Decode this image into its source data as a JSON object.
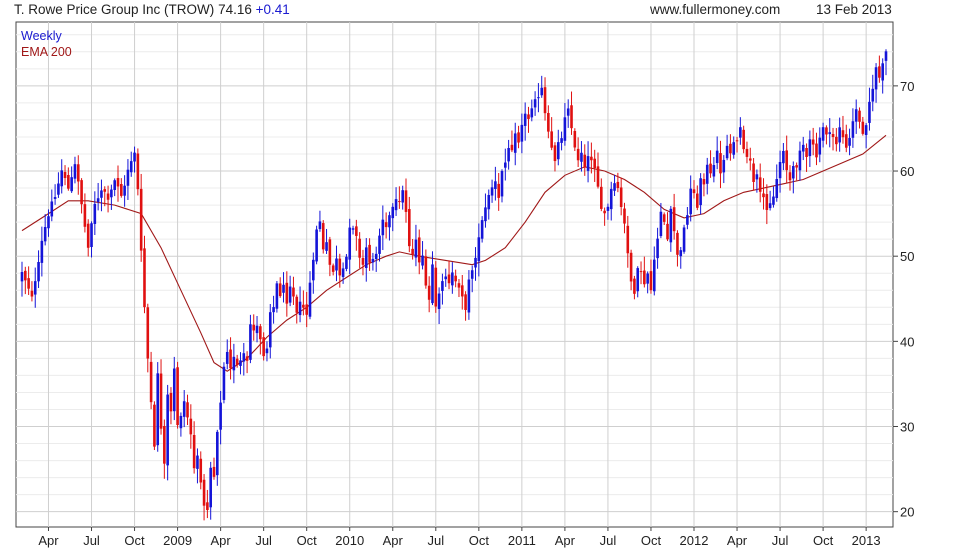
{
  "header": {
    "security_name": "T. Rowe Price Group Inc (TROW)",
    "last_price": "74.16",
    "change": "+0.41",
    "website": "www.fullermoney.com",
    "date": "13 Feb 2013"
  },
  "colors": {
    "up_candle": "#1414d8",
    "down_candle": "#e01010",
    "ema_line": "#a01818",
    "grid": "#cfcfcf",
    "frame": "#444444"
  },
  "chart_data": {
    "type": "candlestick",
    "period": "Weekly",
    "indicator": "EMA 200",
    "y_ticks": [
      20,
      30,
      40,
      50,
      60,
      70
    ],
    "ylim": [
      18.2,
      77.5
    ],
    "x_tick_labels": [
      "Apr",
      "Jul",
      "Oct",
      "2009",
      "Apr",
      "Jul",
      "Oct",
      "2010",
      "Apr",
      "Jul",
      "Oct",
      "2011",
      "Apr",
      "Jul",
      "Oct",
      "2012",
      "Apr",
      "Jul",
      "Oct",
      "2013"
    ],
    "x_tick_weeks": [
      8,
      21,
      34,
      47,
      60,
      73,
      86,
      99,
      112,
      125,
      138,
      151,
      164,
      177,
      190,
      203,
      216,
      229,
      242,
      255
    ],
    "weeks_total": 262,
    "close_path": [
      [
        0,
        48
      ],
      [
        3,
        45
      ],
      [
        6,
        52
      ],
      [
        8,
        55
      ],
      [
        10,
        57
      ],
      [
        12,
        60
      ],
      [
        14,
        58
      ],
      [
        16,
        61
      ],
      [
        18,
        56
      ],
      [
        20,
        51
      ],
      [
        22,
        56
      ],
      [
        24,
        58
      ],
      [
        26,
        57
      ],
      [
        28,
        59
      ],
      [
        30,
        57
      ],
      [
        32,
        60
      ],
      [
        34,
        62
      ],
      [
        35,
        58
      ],
      [
        36,
        51
      ],
      [
        37,
        44
      ],
      [
        38,
        38
      ],
      [
        39,
        33
      ],
      [
        40,
        28
      ],
      [
        41,
        36
      ],
      [
        42,
        30
      ],
      [
        43,
        26
      ],
      [
        44,
        34
      ],
      [
        45,
        32
      ],
      [
        46,
        37
      ],
      [
        47,
        30
      ],
      [
        48,
        31
      ],
      [
        49,
        33
      ],
      [
        50,
        31
      ],
      [
        51,
        29
      ],
      [
        52,
        25
      ],
      [
        53,
        27
      ],
      [
        54,
        23
      ],
      [
        55,
        21
      ],
      [
        56,
        20
      ],
      [
        57,
        25
      ],
      [
        58,
        24
      ],
      [
        59,
        29
      ],
      [
        60,
        33
      ],
      [
        61,
        37
      ],
      [
        62,
        39
      ],
      [
        63,
        37
      ],
      [
        64,
        38
      ],
      [
        65,
        37
      ],
      [
        66,
        38
      ],
      [
        67,
        39
      ],
      [
        68,
        38
      ],
      [
        69,
        42
      ],
      [
        70,
        41
      ],
      [
        71,
        42
      ],
      [
        72,
        40
      ],
      [
        73,
        38
      ],
      [
        74,
        39
      ],
      [
        75,
        43
      ],
      [
        76,
        44
      ],
      [
        77,
        47
      ],
      [
        78,
        45
      ],
      [
        79,
        47
      ],
      [
        80,
        44
      ],
      [
        81,
        46
      ],
      [
        82,
        45
      ],
      [
        83,
        43
      ],
      [
        84,
        45
      ],
      [
        85,
        44
      ],
      [
        86,
        43
      ],
      [
        87,
        47
      ],
      [
        88,
        50
      ],
      [
        89,
        53
      ],
      [
        90,
        54
      ],
      [
        91,
        51
      ],
      [
        92,
        52
      ],
      [
        93,
        49
      ],
      [
        94,
        48
      ],
      [
        95,
        50
      ],
      [
        96,
        48
      ],
      [
        97,
        49
      ],
      [
        98,
        50
      ],
      [
        99,
        53
      ],
      [
        100,
        53
      ],
      [
        101,
        52
      ],
      [
        102,
        50
      ],
      [
        103,
        49
      ],
      [
        104,
        51
      ],
      [
        105,
        49
      ],
      [
        106,
        50
      ],
      [
        107,
        50
      ],
      [
        108,
        52
      ],
      [
        109,
        54
      ],
      [
        110,
        53
      ],
      [
        111,
        55
      ],
      [
        112,
        56
      ],
      [
        113,
        57
      ],
      [
        114,
        56
      ],
      [
        115,
        58
      ],
      [
        116,
        55
      ],
      [
        117,
        51
      ],
      [
        118,
        50
      ],
      [
        119,
        52
      ],
      [
        120,
        49
      ],
      [
        121,
        50
      ],
      [
        122,
        47
      ],
      [
        123,
        45
      ],
      [
        124,
        49
      ],
      [
        125,
        44
      ],
      [
        126,
        46
      ],
      [
        127,
        47
      ],
      [
        128,
        48
      ],
      [
        129,
        47
      ],
      [
        130,
        48
      ],
      [
        131,
        47
      ],
      [
        132,
        46
      ],
      [
        133,
        45
      ],
      [
        134,
        44
      ],
      [
        135,
        47
      ],
      [
        136,
        48
      ],
      [
        137,
        50
      ],
      [
        138,
        52
      ],
      [
        139,
        54
      ],
      [
        140,
        56
      ],
      [
        141,
        57
      ],
      [
        142,
        58
      ],
      [
        143,
        59
      ],
      [
        144,
        57
      ],
      [
        145,
        60
      ],
      [
        146,
        61
      ],
      [
        147,
        63
      ],
      [
        148,
        62
      ],
      [
        149,
        64
      ],
      [
        150,
        63
      ],
      [
        151,
        65
      ],
      [
        152,
        67
      ],
      [
        153,
        66
      ],
      [
        154,
        67
      ],
      [
        155,
        68
      ],
      [
        156,
        69
      ],
      [
        157,
        70
      ],
      [
        158,
        67
      ],
      [
        159,
        65
      ],
      [
        160,
        63
      ],
      [
        161,
        61
      ],
      [
        162,
        63
      ],
      [
        163,
        64
      ],
      [
        164,
        66
      ],
      [
        165,
        67
      ],
      [
        166,
        65
      ],
      [
        167,
        63
      ],
      [
        168,
        61
      ],
      [
        169,
        62
      ],
      [
        170,
        60
      ],
      [
        171,
        62
      ],
      [
        172,
        61
      ],
      [
        173,
        60
      ],
      [
        174,
        58
      ],
      [
        175,
        56
      ],
      [
        176,
        55
      ],
      [
        177,
        56
      ],
      [
        178,
        58
      ],
      [
        179,
        59
      ],
      [
        180,
        58
      ],
      [
        181,
        56
      ],
      [
        182,
        54
      ],
      [
        183,
        50
      ],
      [
        184,
        47
      ],
      [
        185,
        46
      ],
      [
        186,
        49
      ],
      [
        187,
        48
      ],
      [
        188,
        47
      ],
      [
        189,
        48
      ],
      [
        190,
        46
      ],
      [
        191,
        50
      ],
      [
        192,
        52
      ],
      [
        193,
        55
      ],
      [
        194,
        54
      ],
      [
        195,
        52
      ],
      [
        196,
        56
      ],
      [
        197,
        53
      ],
      [
        198,
        50
      ],
      [
        199,
        51
      ],
      [
        200,
        53
      ],
      [
        201,
        55
      ],
      [
        202,
        58
      ],
      [
        203,
        57
      ],
      [
        204,
        56
      ],
      [
        205,
        59
      ],
      [
        206,
        58
      ],
      [
        207,
        61
      ],
      [
        208,
        60
      ],
      [
        209,
        61
      ],
      [
        210,
        62
      ],
      [
        211,
        60
      ],
      [
        212,
        61
      ],
      [
        213,
        63
      ],
      [
        214,
        62
      ],
      [
        215,
        63
      ],
      [
        216,
        64
      ],
      [
        217,
        65
      ],
      [
        218,
        63
      ],
      [
        219,
        62
      ],
      [
        220,
        61
      ],
      [
        221,
        59
      ],
      [
        222,
        60
      ],
      [
        223,
        58
      ],
      [
        224,
        57
      ],
      [
        225,
        55
      ],
      [
        226,
        56
      ],
      [
        227,
        57
      ],
      [
        228,
        59
      ],
      [
        229,
        61
      ],
      [
        230,
        62
      ],
      [
        231,
        60
      ],
      [
        232,
        59
      ],
      [
        233,
        61
      ],
      [
        234,
        60
      ],
      [
        235,
        62
      ],
      [
        236,
        63
      ],
      [
        237,
        62
      ],
      [
        238,
        64
      ],
      [
        239,
        63
      ],
      [
        240,
        62
      ],
      [
        241,
        64
      ],
      [
        242,
        65
      ],
      [
        243,
        64
      ],
      [
        244,
        65
      ],
      [
        245,
        64
      ],
      [
        246,
        63
      ],
      [
        247,
        65
      ],
      [
        248,
        64
      ],
      [
        249,
        63
      ],
      [
        250,
        64
      ],
      [
        251,
        66
      ],
      [
        252,
        67
      ],
      [
        253,
        66
      ],
      [
        254,
        64
      ],
      [
        255,
        65
      ],
      [
        256,
        68
      ],
      [
        257,
        70
      ],
      [
        258,
        72
      ],
      [
        259,
        71
      ],
      [
        260,
        73
      ],
      [
        261,
        74.16
      ]
    ],
    "ema_path": [
      [
        0,
        53
      ],
      [
        8,
        55
      ],
      [
        14,
        56.5
      ],
      [
        20,
        56.5
      ],
      [
        28,
        56
      ],
      [
        36,
        55
      ],
      [
        42,
        51
      ],
      [
        48,
        46
      ],
      [
        54,
        41
      ],
      [
        58,
        37.5
      ],
      [
        62,
        36.5
      ],
      [
        68,
        38
      ],
      [
        74,
        40.5
      ],
      [
        80,
        42.5
      ],
      [
        86,
        44
      ],
      [
        92,
        46
      ],
      [
        98,
        47.5
      ],
      [
        104,
        49
      ],
      [
        110,
        50
      ],
      [
        114,
        50.5
      ],
      [
        120,
        50
      ],
      [
        128,
        49.5
      ],
      [
        136,
        49
      ],
      [
        140,
        49.5
      ],
      [
        146,
        51
      ],
      [
        152,
        54
      ],
      [
        158,
        57.5
      ],
      [
        164,
        59.5
      ],
      [
        170,
        60.5
      ],
      [
        176,
        60
      ],
      [
        182,
        59
      ],
      [
        188,
        57.5
      ],
      [
        194,
        55.5
      ],
      [
        200,
        54.5
      ],
      [
        206,
        55
      ],
      [
        212,
        56.5
      ],
      [
        218,
        57.5
      ],
      [
        224,
        58
      ],
      [
        230,
        58.5
      ],
      [
        236,
        59
      ],
      [
        242,
        60
      ],
      [
        248,
        61
      ],
      [
        254,
        62
      ],
      [
        261,
        64.2
      ]
    ]
  }
}
